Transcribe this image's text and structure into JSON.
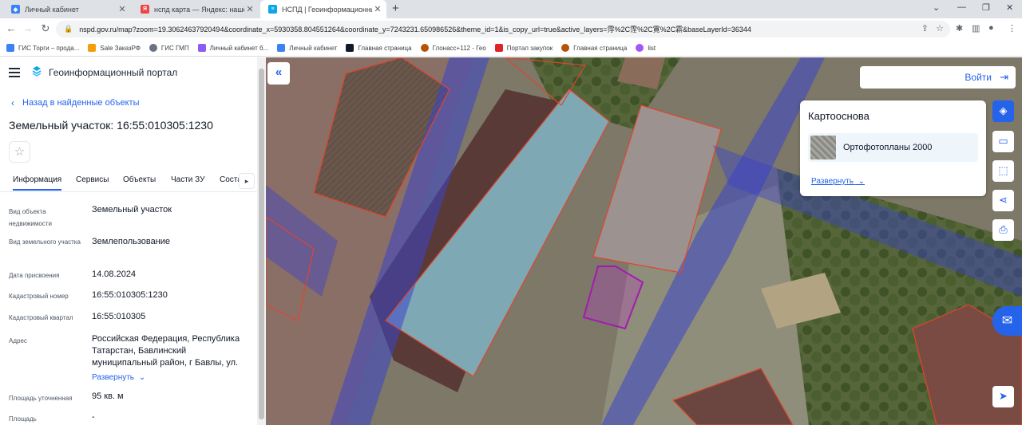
{
  "browser": {
    "tabs": [
      {
        "title": "Личный кабинет",
        "color": "#3b82f6"
      },
      {
        "title": "нспд карта — Яндекс: нашёлся",
        "color": "#ef4444"
      },
      {
        "title": "НСПД | Геоинформационный пор",
        "color": "#0ea5e9"
      }
    ],
    "new_tab": "+",
    "url": "nspd.gov.ru/map?zoom=19.30624637920494&coordinate_x=5930358.804551264&coordinate_y=7243231.650986526&theme_id=1&is_copy_url=true&active_layers=䨕%2C䨙%2C䨘%2C䨛&baseLayerId=36344",
    "bookmarks": [
      {
        "label": "ГИС Торги – прода...",
        "color": "#3b82f6"
      },
      {
        "label": "Sale ЗаказРФ",
        "color": "#f59e0b"
      },
      {
        "label": "ГИС ГМП",
        "color": "#6b7280"
      },
      {
        "label": "Личный кабинет б...",
        "color": "#8b5cf6"
      },
      {
        "label": "Личный кабинет",
        "color": "#3b82f6"
      },
      {
        "label": "Главная страница",
        "color": "#111827"
      },
      {
        "label": "Глонасс+112 - Гео",
        "color": "#b45309"
      },
      {
        "label": "Портал закупок",
        "color": "#dc2626"
      },
      {
        "label": "Главная страница",
        "color": "#b45309"
      },
      {
        "label": "list",
        "color": "#a855f7"
      }
    ]
  },
  "panel": {
    "portal_title": "Геоинформационный портал",
    "back_link": "Назад в найденные объекты",
    "object_title": "Земельный участок: 16:55:010305:1230",
    "tabs": [
      "Информация",
      "Сервисы",
      "Объекты",
      "Части ЗУ",
      "Соста"
    ],
    "rows": [
      {
        "label": "Вид объекта недвижимости",
        "value": "Земельный участок"
      },
      {
        "label": "Вид земельного участка",
        "value": "Землепользование"
      },
      {
        "label": "Дата присвоения",
        "value": "14.08.2024"
      },
      {
        "label": "Кадастровый номер",
        "value": "16:55:010305:1230"
      },
      {
        "label": "Кадастровый квартал",
        "value": "16:55:010305"
      },
      {
        "label": "Адрес",
        "value": "Российская Федерация, Республика Татарстан, Бавлинский муниципальный район, г Бавлы, ул."
      },
      {
        "label": "Площадь уточненная",
        "value": "95 кв. м"
      },
      {
        "label": "Площадь",
        "value": "-"
      }
    ],
    "expand_label": "Развернуть"
  },
  "map": {
    "login_label": "Войти",
    "basemap_title": "Картооснова",
    "basemap_item": "Ортофотопланы 2000",
    "basemap_expand": "Развернуть",
    "accent": "#2563eb"
  }
}
